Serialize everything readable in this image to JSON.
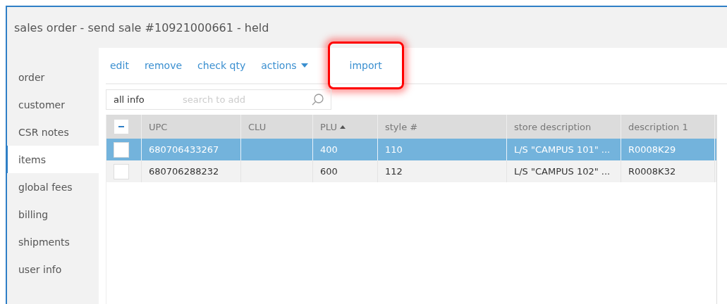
{
  "window": {
    "title": "sales order - send sale #10921000661 - held"
  },
  "sidebar": {
    "items": [
      {
        "label": "order",
        "selected": false
      },
      {
        "label": "customer",
        "selected": false
      },
      {
        "label": "CSR notes",
        "selected": false
      },
      {
        "label": "items",
        "selected": true
      },
      {
        "label": "global fees",
        "selected": false
      },
      {
        "label": "billing",
        "selected": false
      },
      {
        "label": "shipments",
        "selected": false
      },
      {
        "label": "user info",
        "selected": false
      }
    ]
  },
  "toolbar": {
    "actions": [
      {
        "label": "edit",
        "kind": "link",
        "highlighted": false
      },
      {
        "label": "remove",
        "kind": "link",
        "highlighted": false
      },
      {
        "label": "check qty",
        "kind": "link",
        "highlighted": false
      },
      {
        "label": "actions",
        "kind": "dropdown",
        "highlighted": false
      },
      {
        "label": "import",
        "kind": "link",
        "highlighted": true
      }
    ]
  },
  "search": {
    "scope": "all info",
    "placeholder": "search to add"
  },
  "table": {
    "select_all_partial": true,
    "columns": [
      {
        "label": "UPC",
        "sorted": false
      },
      {
        "label": "CLU",
        "sorted": false
      },
      {
        "label": "PLU",
        "sorted": true
      },
      {
        "label": "style #",
        "sorted": false
      },
      {
        "label": "store description",
        "sorted": false
      },
      {
        "label": "description 1",
        "sorted": false
      }
    ],
    "rows": [
      {
        "selected": true,
        "checked": false,
        "cells": [
          "680706433267",
          "",
          "400",
          "110",
          "L/S \"CAMPUS 101\" ...",
          "R0008K29"
        ]
      },
      {
        "selected": false,
        "checked": false,
        "cells": [
          "680706288232",
          "",
          "600",
          "112",
          "L/S \"CAMPUS 102\" ...",
          "R0008K32"
        ]
      }
    ]
  }
}
